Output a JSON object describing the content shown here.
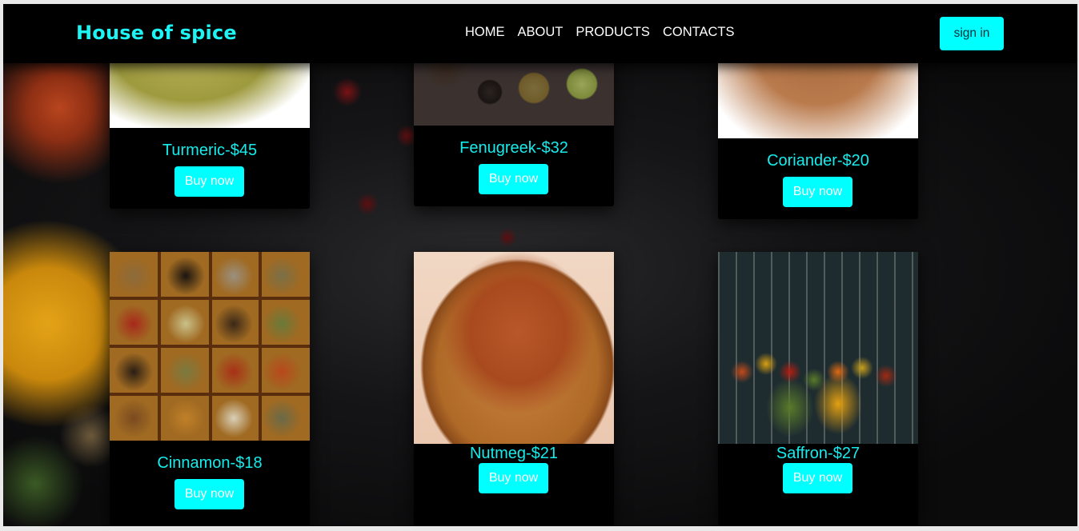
{
  "navbar": {
    "brand": "House of spice",
    "links": [
      "HOME",
      "ABOUT",
      "PRODUCTS",
      "CONTACTS"
    ],
    "signin_label": "sign in"
  },
  "products": [
    {
      "title": "Turmeric-$45",
      "button": "Buy now"
    },
    {
      "title": "Fenugreek-$32",
      "button": "Buy now"
    },
    {
      "title": "Coriander-$20",
      "button": "Buy now"
    },
    {
      "title": "Cinnamon-$18",
      "button": "Buy now"
    },
    {
      "title": "Nutmeg-$21",
      "button": "Buy now"
    },
    {
      "title": "Saffron-$27",
      "button": "Buy now"
    }
  ],
  "colors": {
    "accent": "#00ffff",
    "brand_text": "#1ef4f4",
    "navbar_bg": "#000000",
    "card_bg": "#000000"
  }
}
